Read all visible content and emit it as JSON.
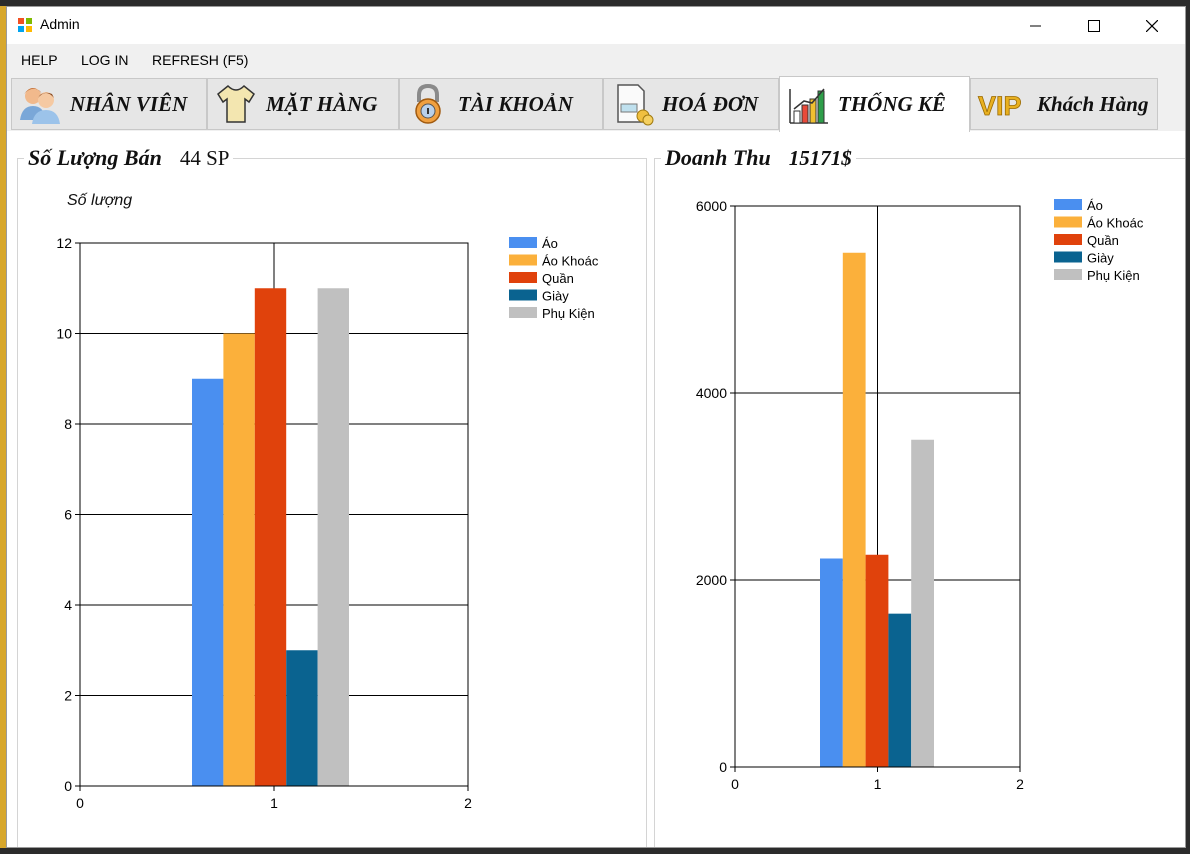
{
  "window": {
    "title": "Admin"
  },
  "menu": {
    "items": [
      "HELP",
      "LOG IN",
      "REFRESH (F5)"
    ]
  },
  "tabs": [
    {
      "label": "NHÂN VIÊN",
      "icon": "users-icon"
    },
    {
      "label": "MẶT HÀNG",
      "icon": "shirt-icon"
    },
    {
      "label": "TÀI KHOẢN",
      "icon": "padlock-icon"
    },
    {
      "label": "HOÁ ĐƠN",
      "icon": "invoice-coins-icon"
    },
    {
      "label": "THỐNG KÊ",
      "icon": "bar-chart-icon",
      "active": true
    },
    {
      "label": "Khách Hàng",
      "icon": "vip-icon"
    }
  ],
  "vip_logo_text": "VIP",
  "stats": {
    "quantity_group": {
      "label": "Số Lượng Bán",
      "value": "44 SP"
    },
    "revenue_group": {
      "label": "Doanh Thu",
      "value": "15171$"
    }
  },
  "chart_data": [
    {
      "type": "bar",
      "title": "",
      "ylabel": "Số lượng",
      "xlabel": "",
      "x_ticks": [
        "0",
        "1",
        "2"
      ],
      "y_ticks": [
        "0",
        "2",
        "4",
        "6",
        "8",
        "10",
        "12"
      ],
      "ylim": [
        0,
        12
      ],
      "xlim": [
        0,
        2
      ],
      "grid": true,
      "legend_position": "top-right",
      "categories": [
        "1"
      ],
      "series": [
        {
          "name": "Áo",
          "values": [
            9
          ],
          "color": "#4a8ff0"
        },
        {
          "name": "Áo Khoác",
          "values": [
            10
          ],
          "color": "#fbb03b"
        },
        {
          "name": "Quần",
          "values": [
            11
          ],
          "color": "#e0420c"
        },
        {
          "name": "Giày",
          "values": [
            3
          ],
          "color": "#0a6390"
        },
        {
          "name": "Phụ Kiện",
          "values": [
            11
          ],
          "color": "#c0c0c0"
        }
      ]
    },
    {
      "type": "bar",
      "title": "",
      "ylabel": "",
      "xlabel": "",
      "x_ticks": [
        "0",
        "1",
        "2"
      ],
      "y_ticks": [
        "0",
        "2000",
        "4000",
        "6000"
      ],
      "ylim": [
        0,
        6000
      ],
      "xlim": [
        0,
        2
      ],
      "grid": true,
      "legend_position": "top-right",
      "categories": [
        "1"
      ],
      "series": [
        {
          "name": "Áo",
          "values": [
            2230
          ],
          "color": "#4a8ff0"
        },
        {
          "name": "Áo Khoác",
          "values": [
            5500
          ],
          "color": "#fbb03b"
        },
        {
          "name": "Quần",
          "values": [
            2270
          ],
          "color": "#e0420c"
        },
        {
          "name": "Giày",
          "values": [
            1640
          ],
          "color": "#0a6390"
        },
        {
          "name": "Phụ Kiện",
          "values": [
            3500
          ],
          "color": "#c0c0c0"
        }
      ]
    }
  ]
}
